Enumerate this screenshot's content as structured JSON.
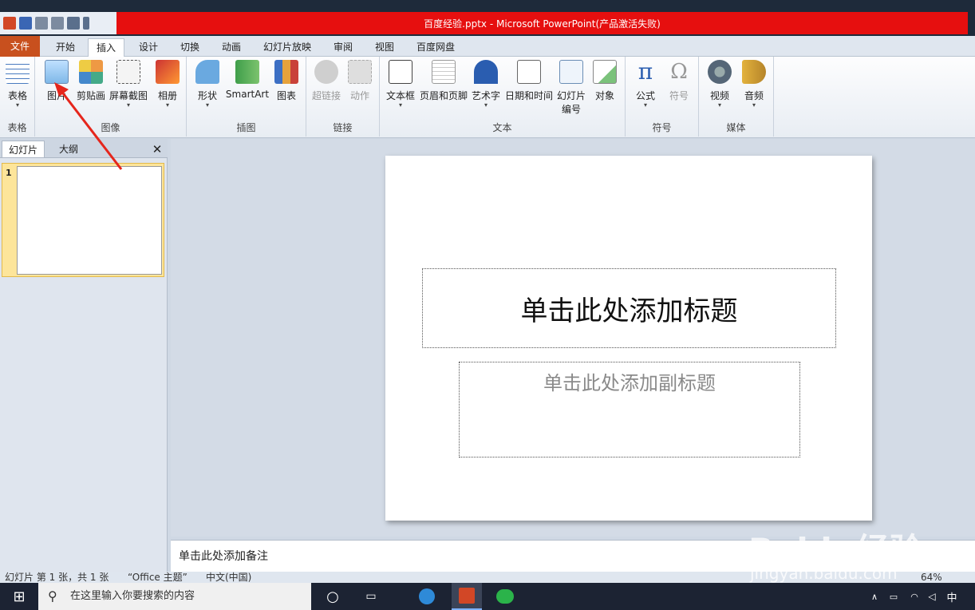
{
  "window": {
    "title": "百度经验.pptx - Microsoft PowerPoint(产品激活失败)"
  },
  "tabs": [
    {
      "label": "文件"
    },
    {
      "label": "开始"
    },
    {
      "label": "插入"
    },
    {
      "label": "设计"
    },
    {
      "label": "切换"
    },
    {
      "label": "动画"
    },
    {
      "label": "幻灯片放映"
    },
    {
      "label": "审阅"
    },
    {
      "label": "视图"
    },
    {
      "label": "百度网盘"
    }
  ],
  "ribbon": {
    "groups": {
      "table": "表格",
      "image": "图像",
      "illustration": "插图",
      "link": "链接",
      "text": "文本",
      "symbol": "符号",
      "media": "媒体"
    },
    "buttons": {
      "table": "表格",
      "picture": "图片",
      "clipart": "剪贴画",
      "screenshot": "屏幕截图",
      "album": "相册",
      "shapes": "形状",
      "smartart": "SmartArt",
      "chart": "图表",
      "hyperlink": "超链接",
      "action": "动作",
      "textbox": "文本框",
      "headerfooter": "页眉和页脚",
      "wordart": "艺术字",
      "datetime": "日期和时间",
      "slidenum1": "幻灯片",
      "slidenum2": "编号",
      "object": "对象",
      "equation": "公式",
      "symbol": "符号",
      "video": "视频",
      "audio": "音频"
    }
  },
  "leftpane": {
    "tab_slides": "幻灯片",
    "tab_outline": "大纲",
    "slide_number": "1"
  },
  "slide": {
    "title_placeholder": "单击此处添加标题",
    "subtitle_placeholder": "单击此处添加副标题"
  },
  "notes": {
    "placeholder": "单击此处添加备注"
  },
  "status": {
    "slide_info": "幻灯片 第 1 张，共 1 张",
    "theme": "“Office 主题”",
    "language": "中文(中国)",
    "zoom": "64%"
  },
  "taskbar": {
    "search_placeholder": "在这里输入你要搜索的内容",
    "ime": "中"
  },
  "colors": {
    "title_bar": "#e60f0f",
    "file_tab": "#c8501e",
    "thumb_highlight": "#fde59a",
    "arrow": "#e5261c"
  },
  "watermark": {
    "brand": "Baidu经验",
    "url": "jingyan.baidu.com"
  }
}
